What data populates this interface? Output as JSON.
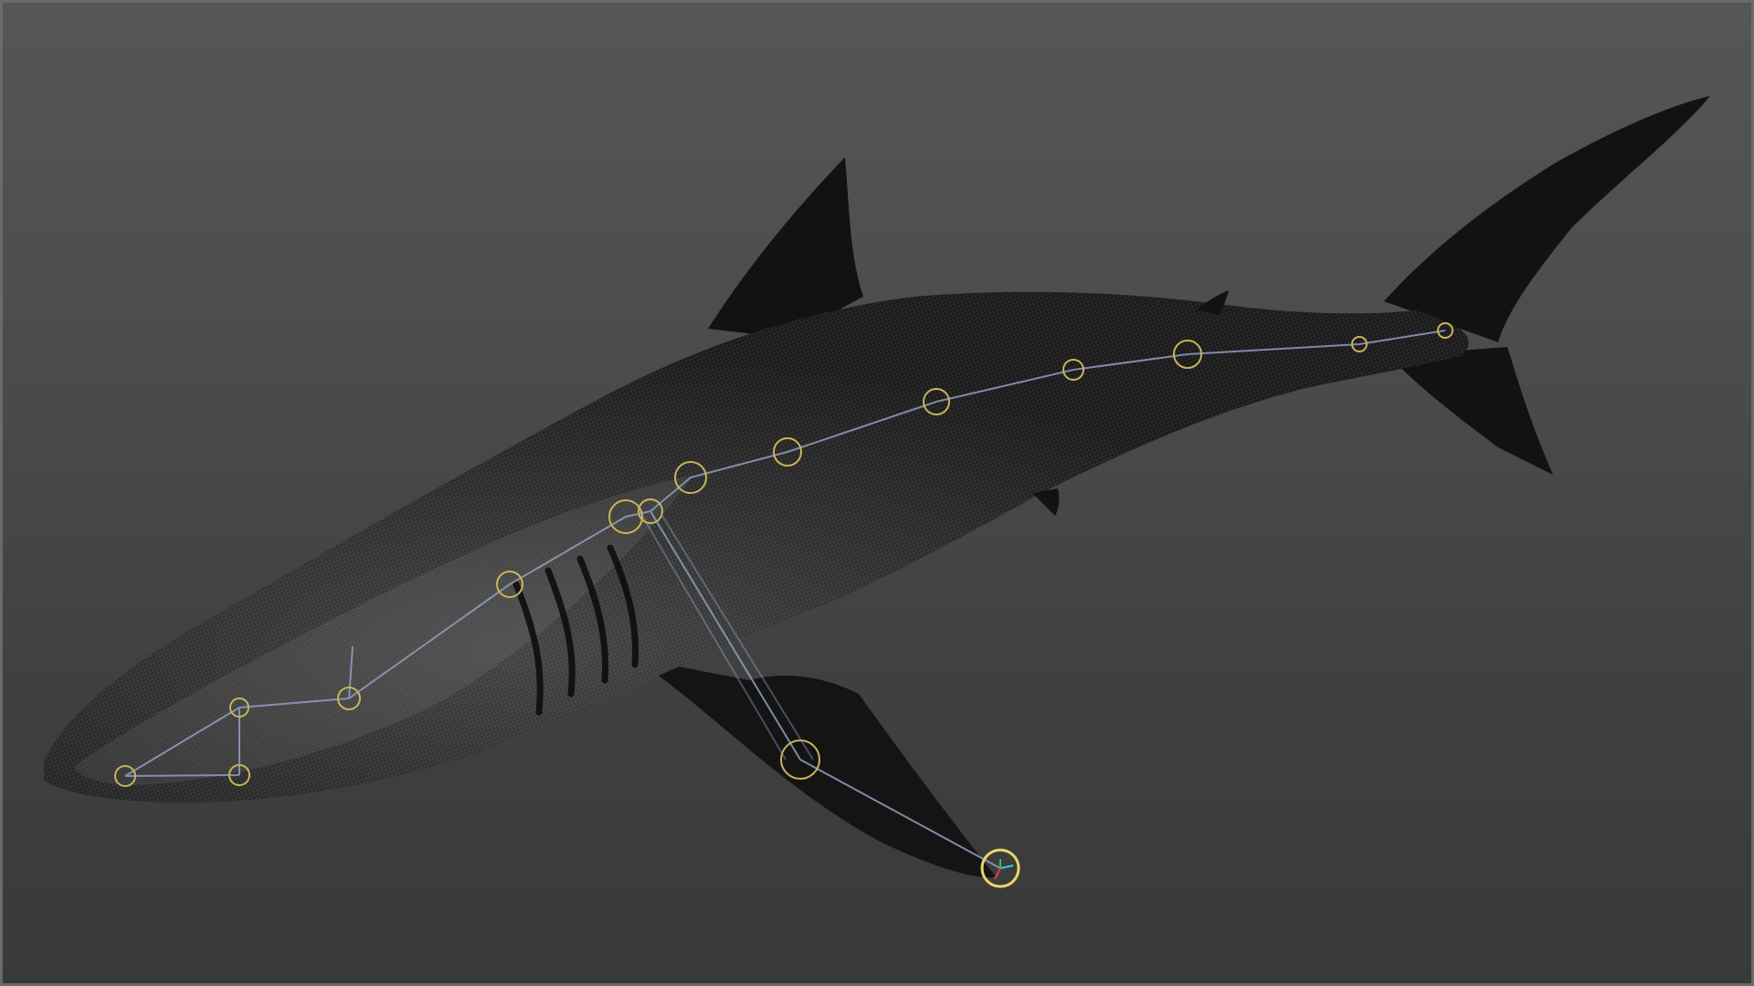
{
  "viewport": {
    "background_top": "#565656",
    "background_bottom": "#393939"
  },
  "model": {
    "type": "shark-mesh-wireframe",
    "body_color": "#161616",
    "mesh_line_color": "#8a8a8a"
  },
  "rig": {
    "joint_color": "#c9b45a",
    "bone_color": "#8f9fc0",
    "selected_joint_color": "#e8d66a"
  }
}
